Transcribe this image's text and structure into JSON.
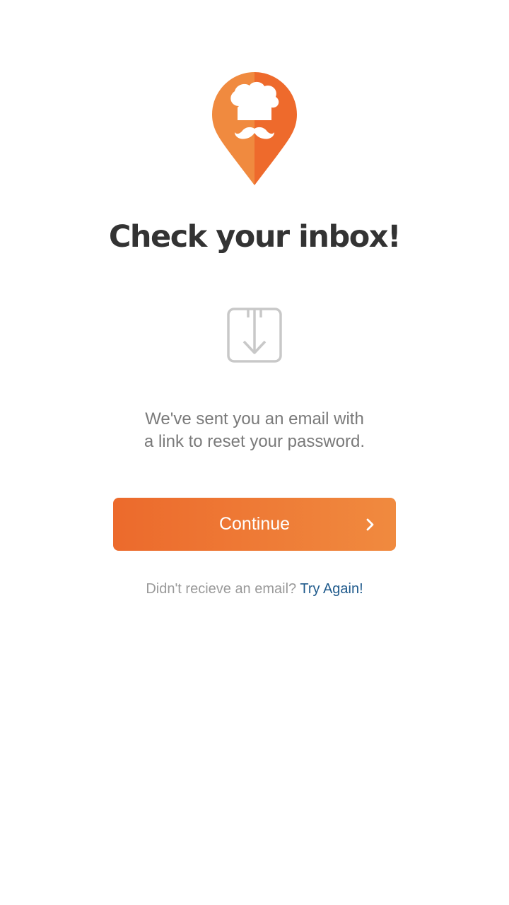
{
  "header": {
    "title": "Check your inbox!"
  },
  "icons": {
    "logo": "chef-pin-logo",
    "inbox": "inbox-download-icon",
    "chevron": "chevron-right-icon"
  },
  "message": {
    "line1": "We've sent you an email with",
    "line2": "a link to reset your password."
  },
  "continue_button": {
    "label": "Continue"
  },
  "footer": {
    "prompt": "Didn't recieve an email?",
    "link_label": "Try Again!"
  },
  "colors": {
    "accent": "#EE6A2C",
    "accent_light": "#F08A3F",
    "title": "#333333",
    "message": "#7A7A7A",
    "link": "#1F5A8C"
  }
}
